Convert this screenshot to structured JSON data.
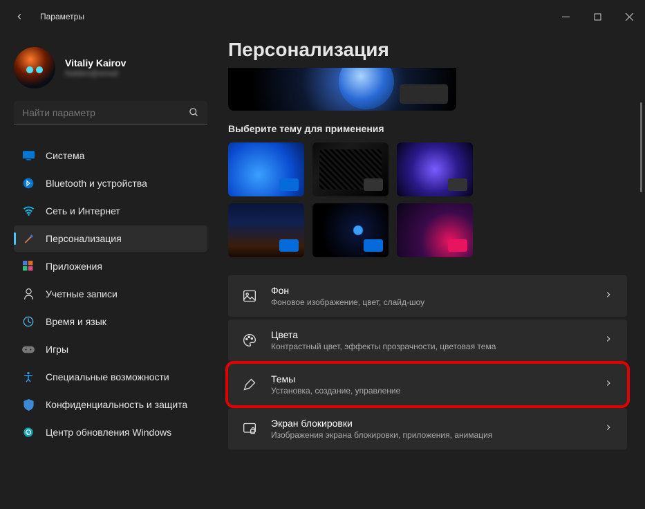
{
  "window": {
    "title": "Параметры"
  },
  "user": {
    "name": "Vitaliy Kairov",
    "email": "hidden@email"
  },
  "search": {
    "placeholder": "Найти параметр"
  },
  "nav": [
    {
      "label": "Система"
    },
    {
      "label": "Bluetooth и устройства"
    },
    {
      "label": "Сеть и Интернет"
    },
    {
      "label": "Персонализация"
    },
    {
      "label": "Приложения"
    },
    {
      "label": "Учетные записи"
    },
    {
      "label": "Время и язык"
    },
    {
      "label": "Игры"
    },
    {
      "label": "Специальные возможности"
    },
    {
      "label": "Конфиденциальность и защита"
    },
    {
      "label": "Центр обновления Windows"
    }
  ],
  "page": {
    "title": "Персонализация",
    "theme_label": "Выберите тему для применения"
  },
  "settings": [
    {
      "title": "Фон",
      "sub": "Фоновое изображение, цвет, слайд-шоу"
    },
    {
      "title": "Цвета",
      "sub": "Контрастный цвет, эффекты прозрачности, цветовая тема"
    },
    {
      "title": "Темы",
      "sub": "Установка, создание, управление"
    },
    {
      "title": "Экран блокировки",
      "sub": "Изображения экрана блокировки, приложения, анимация"
    }
  ]
}
